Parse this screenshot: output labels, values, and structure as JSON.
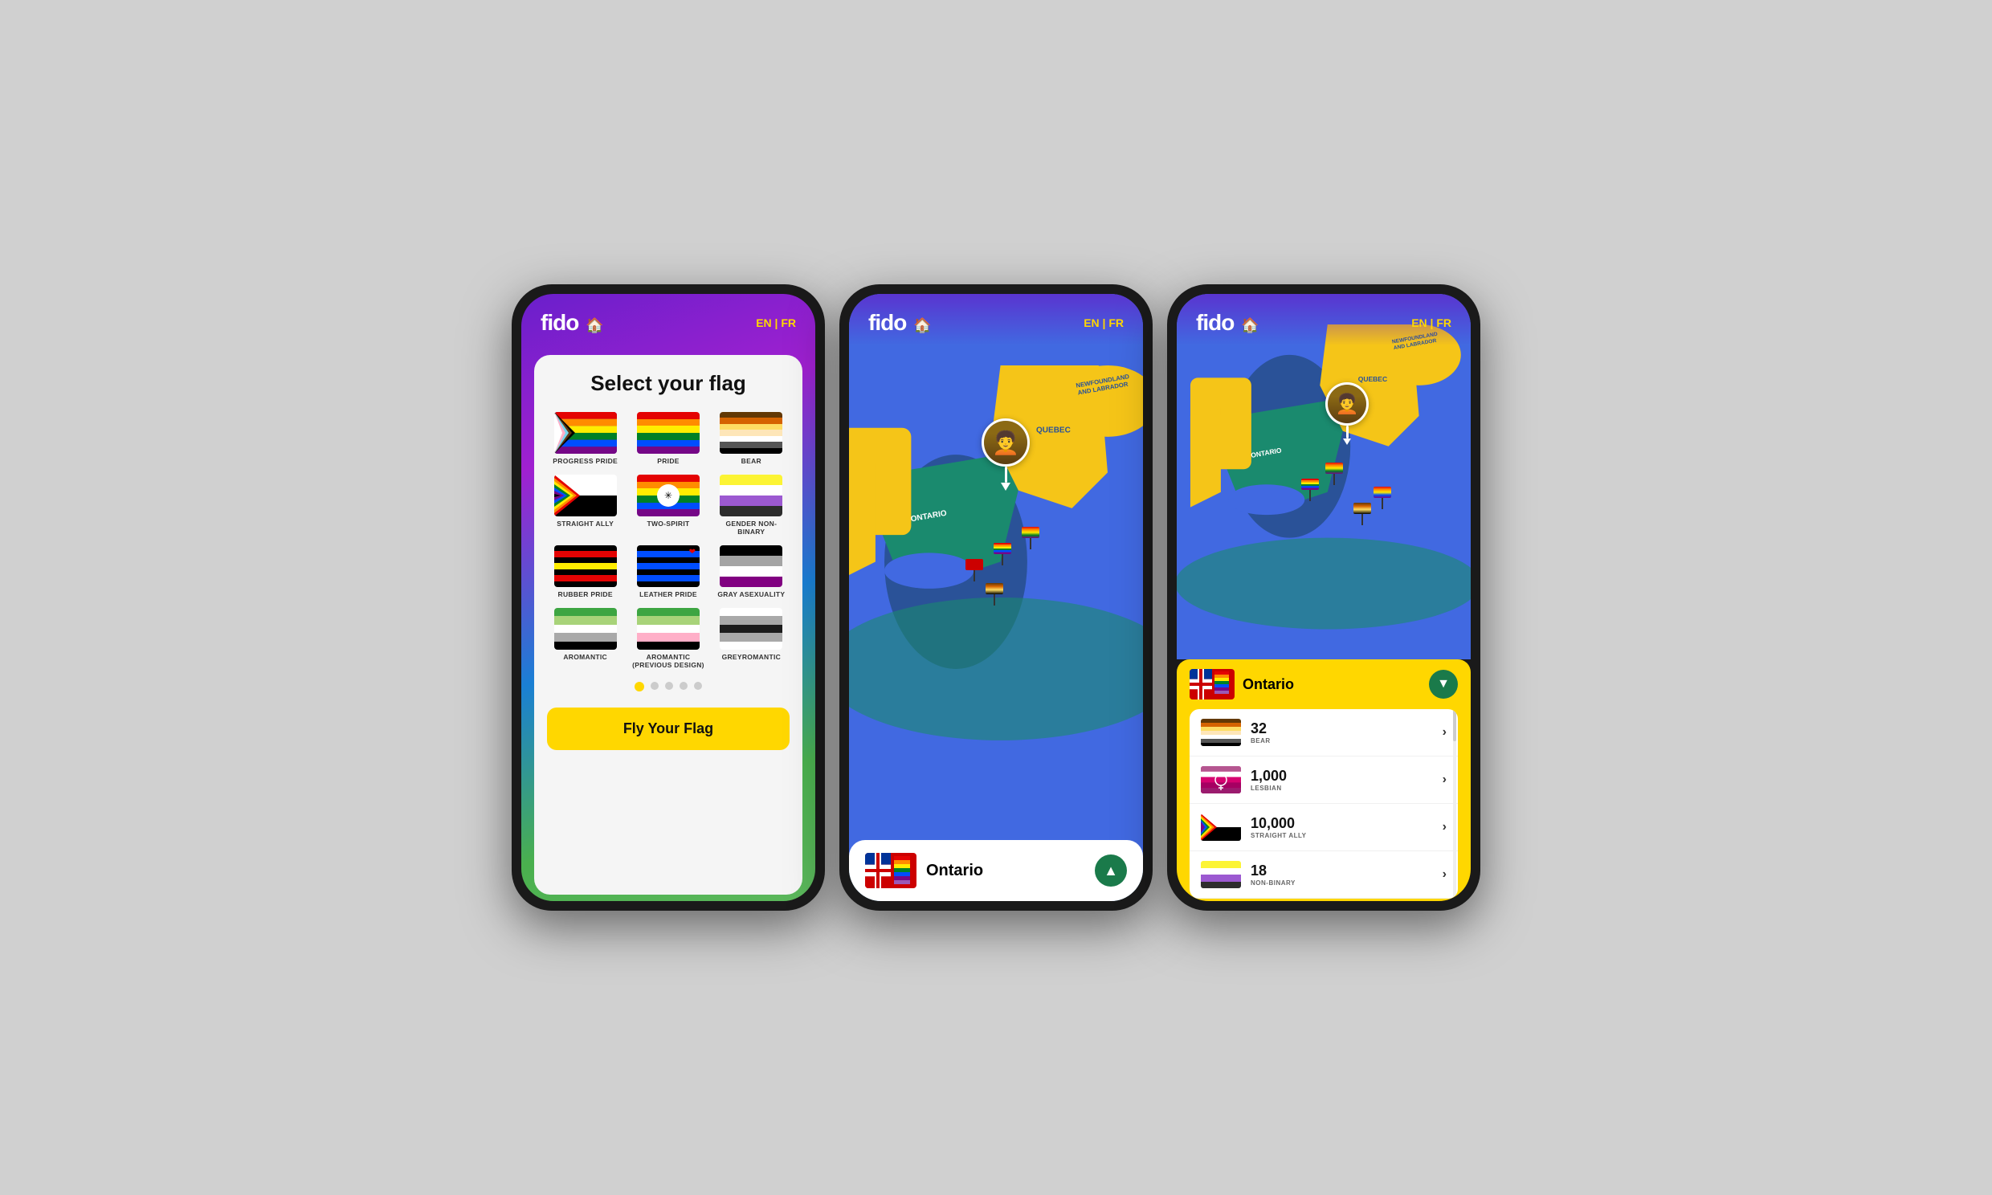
{
  "app": {
    "name": "fido",
    "lang_switch": "EN | FR",
    "house_icon": "🏠"
  },
  "phone1": {
    "title": "Select your flag",
    "flags": [
      {
        "id": "progress-pride",
        "label": "PROGRESS PRIDE"
      },
      {
        "id": "pride",
        "label": "PRIDE"
      },
      {
        "id": "bear",
        "label": "BEAR"
      },
      {
        "id": "straight-ally",
        "label": "STRAIGHT ALLY"
      },
      {
        "id": "two-spirit",
        "label": "TWO-SPIRIT"
      },
      {
        "id": "gender-non-binary",
        "label": "GENDER NON-BINARY"
      },
      {
        "id": "rubber-pride",
        "label": "RUBBER PRIDE"
      },
      {
        "id": "leather-pride",
        "label": "LEATHER PRIDE"
      },
      {
        "id": "gray-asexuality",
        "label": "GRAY ASEXUALITY"
      },
      {
        "id": "aromantic",
        "label": "AROMANTIC"
      },
      {
        "id": "aromantic-prev",
        "label": "AROMANTIC (PREVIOUS DESIGN)"
      },
      {
        "id": "greyromantic",
        "label": "GREYROMANTIC"
      }
    ],
    "cta_button": "Fly Your Flag",
    "pagination": {
      "active": 0,
      "total": 5
    }
  },
  "phone2": {
    "province": "Ontario",
    "chevron": "up",
    "map_labels": {
      "newfoundland": "NEWFOUNDLAND AND LABRADOR",
      "quebec": "QUEBEC",
      "ontario": "ONTARIO"
    }
  },
  "phone3": {
    "province": "Ontario",
    "chevron": "down",
    "stats": [
      {
        "flag_id": "bear",
        "flag_label": "BEAR",
        "count": "32"
      },
      {
        "flag_id": "lesbian",
        "flag_label": "LESBIAN",
        "count": "1,000"
      },
      {
        "flag_id": "straight-ally",
        "flag_label": "STRAIGHT ALLY",
        "count": "10,000"
      },
      {
        "flag_id": "non-binary",
        "flag_label": "NON-BINARY",
        "count": "18"
      }
    ],
    "map_labels": {
      "newfoundland": "NEWFOUNDLAND AND LABRADOR",
      "quebec": "QUEBEC",
      "ontario": "ONTARIO"
    }
  },
  "colors": {
    "yellow": "#FFD700",
    "purple": "#6a1fcb",
    "green": "#2ea84a",
    "blue": "#4169e1",
    "teal": "#1a8a6e",
    "red": "#E40303",
    "dark_green_btn": "#1a7a4a"
  }
}
